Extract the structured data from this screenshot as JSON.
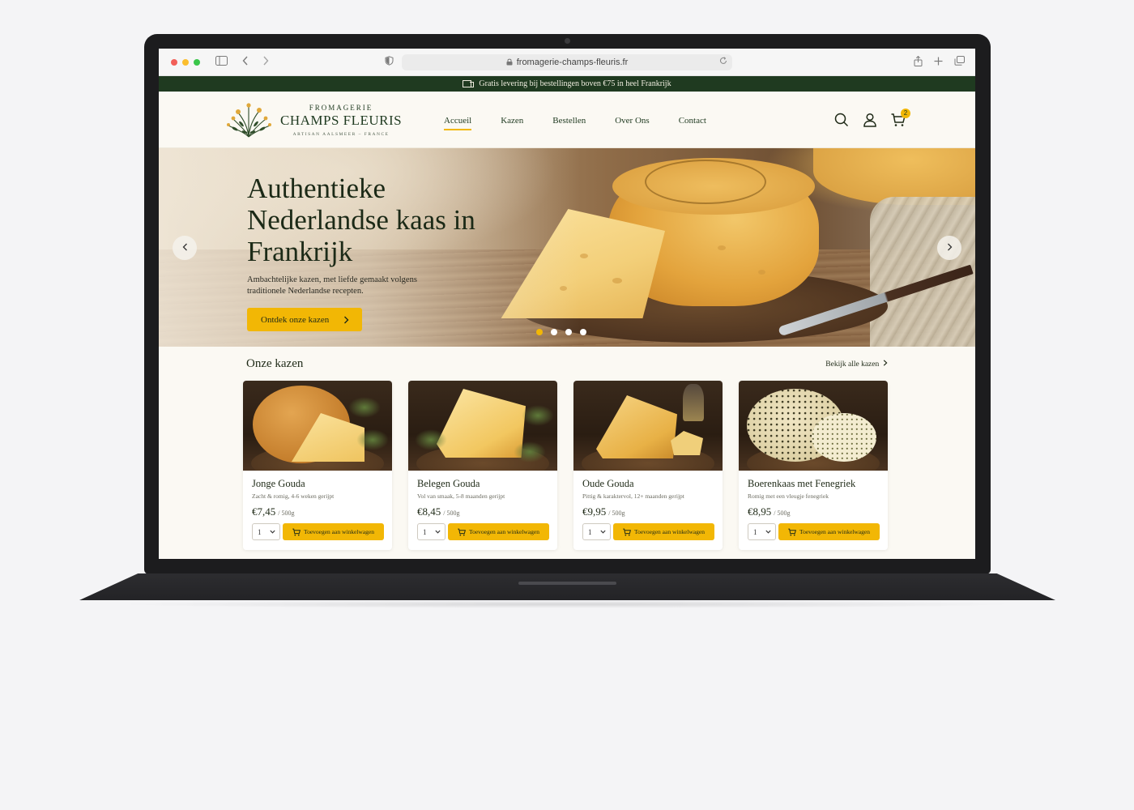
{
  "browser": {
    "url": "fromagerie-champs-fleuris.fr"
  },
  "announcement": {
    "text": "Gratis levering bij bestellingen boven €75 in heel Frankrijk"
  },
  "header": {
    "logo": {
      "top": "FROMAGERIE",
      "main": "CHAMPS FLEURIS",
      "sub": "ARTISAN AALSMEER – FRANCE"
    },
    "nav": [
      {
        "label": "Accueil",
        "active": true
      },
      {
        "label": "Kazen",
        "active": false
      },
      {
        "label": "Bestellen",
        "active": false
      },
      {
        "label": "Over Ons",
        "active": false
      },
      {
        "label": "Contact",
        "active": false
      }
    ],
    "cart_count": "2"
  },
  "hero": {
    "title": "Authentieke Nederlandse kaas in Frankrijk",
    "subtitle": "Ambachtelijke kazen, met liefde gemaakt volgens traditionele Nederlandse recepten.",
    "cta_label": "Ontdek onze kazen",
    "slides": 4,
    "active_slide": 1
  },
  "products": {
    "title": "Onze kazen",
    "see_all": "Bekijk alle kazen",
    "items": [
      {
        "name": "Jonge Gouda",
        "description": "Zacht & romig, 4-6 weken gerijpt",
        "price": "€7,45",
        "unit": "/ 500g",
        "qty": "1",
        "add_label": "Toevoegen aan winkelwagen"
      },
      {
        "name": "Belegen Gouda",
        "description": "Vol van smaak, 5-8 maanden gerijpt",
        "price": "€8,45",
        "unit": "/ 500g",
        "qty": "1",
        "add_label": "Toevoegen aan winkelwagen"
      },
      {
        "name": "Oude Gouda",
        "description": "Pittig & karaktervol, 12+ maanden gerijpt",
        "price": "€9,95",
        "unit": "/ 500g",
        "qty": "1",
        "add_label": "Toevoegen aan winkelwagen"
      },
      {
        "name": "Boerenkaas met Fenegriek",
        "description": "Romig met een vleugje fenegriek",
        "price": "€8,95",
        "unit": "/ 500g",
        "qty": "1",
        "add_label": "Toevoegen aan winkelwagen"
      }
    ]
  },
  "colors": {
    "brand_green": "#1f3a20",
    "accent_yellow": "#f2b705",
    "page_bg": "#fbf9f3"
  },
  "icons": [
    "sidebar-icon",
    "back-icon",
    "forward-icon",
    "shield-icon",
    "lock-icon",
    "reload-icon",
    "share-icon",
    "new-tab-icon",
    "tabs-icon",
    "truck-icon",
    "search-icon",
    "account-icon",
    "cart-icon",
    "chevron-left-icon",
    "chevron-right-icon",
    "chevron-down-icon"
  ]
}
